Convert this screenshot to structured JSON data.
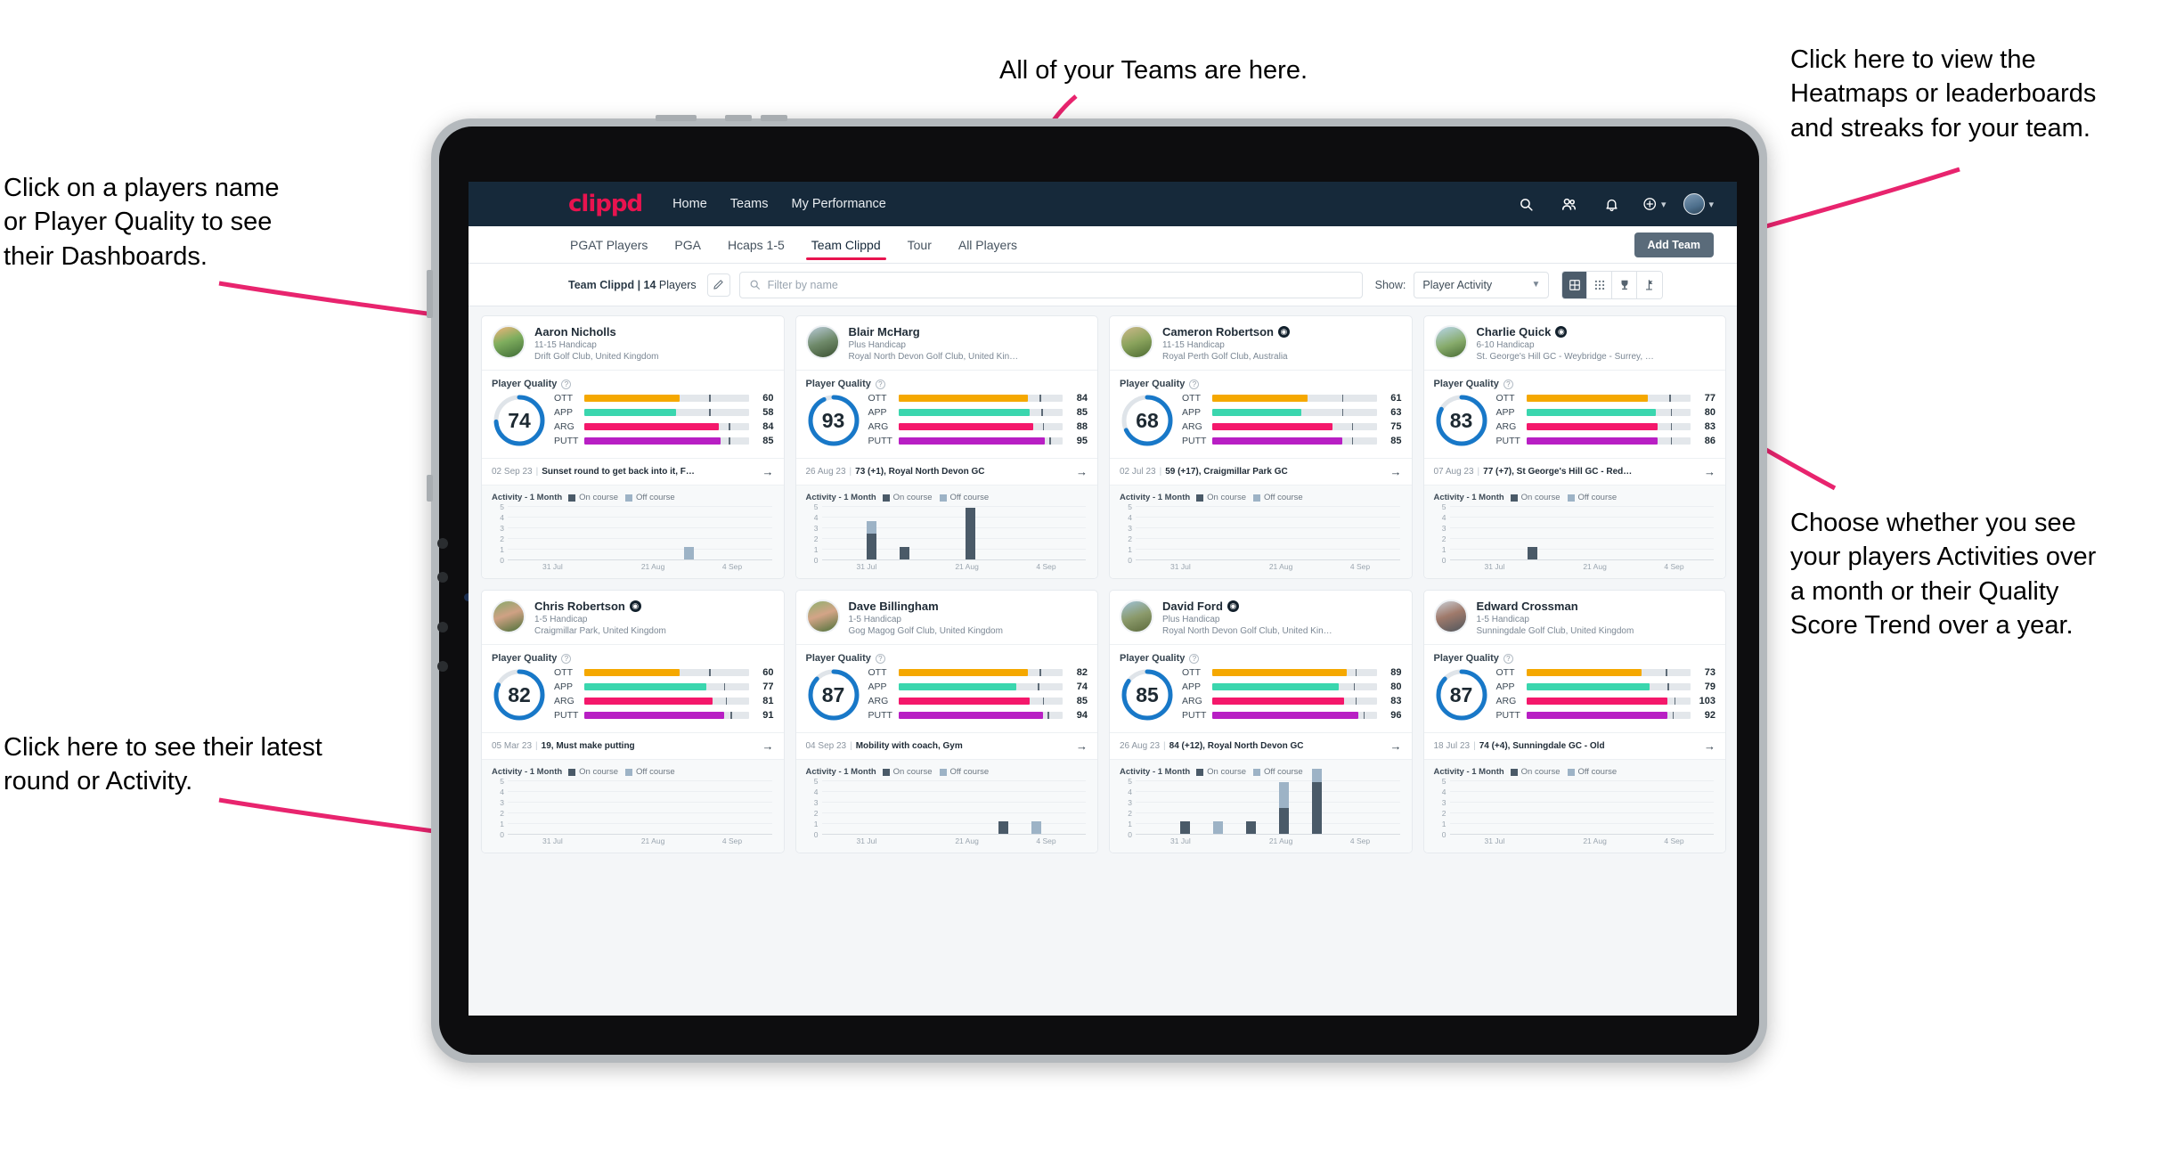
{
  "annotations": {
    "teams": "All of your Teams are here.",
    "heatmaps": "Click here to view the\nHeatmaps or leaderboards\nand streaks for your team.",
    "players": "Click on a players name\nor Player Quality to see\ntheir Dashboards.",
    "choose": "Choose whether you see\nyour players Activities over\na month or their Quality\nScore Trend over a year.",
    "latest": "Click here to see their latest\nround or Activity."
  },
  "colors": {
    "brand": "#e8134f",
    "navbar": "#16293a",
    "accent_blue": "#1878c8",
    "ott": "#f5a800",
    "app": "#3ad6ae",
    "arg": "#f4186b",
    "putt": "#b81fc4",
    "on_course": "#4a5a68",
    "off_course": "#9db3c6",
    "annotation_arrow": "#e8246e"
  },
  "topnav": {
    "brand": "clippd",
    "links": [
      "Home",
      "Teams",
      "My Performance"
    ],
    "icons": [
      "search-icon",
      "people-icon",
      "bell-icon",
      "plus-circle-icon",
      "avatar"
    ]
  },
  "subnav": {
    "tabs": [
      "PGAT Players",
      "PGA",
      "Hcaps 1-5",
      "Team Clippd",
      "Tour",
      "All Players"
    ],
    "active": "Team Clippd",
    "add_team_label": "Add Team"
  },
  "toolbar": {
    "team_name": "Team Clippd",
    "team_separator": " | ",
    "player_count": "14",
    "players_word": " Players",
    "edit_icon": "pencil-icon",
    "search_placeholder": "Filter by name",
    "search_value": "",
    "show_label": "Show:",
    "show_value": "Player Activity",
    "view_buttons": [
      {
        "name": "grid-view-icon",
        "active": true
      },
      {
        "name": "dots-grid-view-icon",
        "active": false
      },
      {
        "name": "trophy-view-icon",
        "active": false
      },
      {
        "name": "flag-view-icon",
        "active": false
      }
    ]
  },
  "card_labels": {
    "player_quality": "Player Quality",
    "activity_title": "Activity - 1 Month",
    "legend_on": "On course",
    "legend_off": "Off course",
    "arrow": "→",
    "help_icon": "help-circle-icon"
  },
  "chart_data": {
    "type": "bar",
    "title": "Activity - 1 Month",
    "xlabel": "",
    "ylabel": "",
    "ylim": [
      0,
      5
    ],
    "yticks": [
      0,
      1,
      2,
      3,
      4,
      5
    ],
    "grid": true,
    "legend": [
      "On course",
      "Off course"
    ],
    "legend_position": "top",
    "x_tick_labels": [
      "31 Jul",
      "21 Aug",
      "4 Sep"
    ],
    "x_tick_positions": [
      0.17,
      0.55,
      0.85
    ],
    "bins": 8,
    "charts": [
      {
        "player": "Aaron Nicholls",
        "on_course": [
          0,
          0,
          0,
          0,
          0,
          0,
          0,
          0
        ],
        "off_course": [
          0,
          0,
          0,
          0,
          0,
          1,
          0,
          0
        ]
      },
      {
        "player": "Blair McHarg",
        "on_course": [
          0,
          2,
          1,
          0,
          4,
          0,
          0,
          0
        ],
        "off_course": [
          0,
          1,
          0,
          0,
          0,
          0,
          0,
          0
        ]
      },
      {
        "player": "Cameron Robertson",
        "on_course": [
          0,
          0,
          0,
          0,
          0,
          0,
          0,
          0
        ],
        "off_course": [
          0,
          0,
          0,
          0,
          0,
          0,
          0,
          0
        ]
      },
      {
        "player": "Charlie Quick",
        "on_course": [
          0,
          0,
          1,
          0,
          0,
          0,
          0,
          0
        ],
        "off_course": [
          0,
          0,
          0,
          0,
          0,
          0,
          0,
          0
        ]
      },
      {
        "player": "Chris Robertson",
        "on_course": [
          0,
          0,
          0,
          0,
          0,
          0,
          0,
          0
        ],
        "off_course": [
          0,
          0,
          0,
          0,
          0,
          0,
          0,
          0
        ]
      },
      {
        "player": "Dave Billingham",
        "on_course": [
          0,
          0,
          0,
          0,
          0,
          1,
          0,
          0
        ],
        "off_course": [
          0,
          0,
          0,
          0,
          0,
          0,
          1,
          0
        ]
      },
      {
        "player": "David Ford",
        "on_course": [
          0,
          1,
          0,
          1,
          2,
          4,
          0,
          0
        ],
        "off_course": [
          0,
          0,
          1,
          0,
          2,
          1,
          0,
          0
        ]
      },
      {
        "player": "Edward Crossman",
        "on_course": [
          0,
          0,
          0,
          0,
          0,
          0,
          0,
          0
        ],
        "off_course": [
          0,
          0,
          0,
          0,
          0,
          0,
          0,
          0
        ]
      }
    ]
  },
  "players": [
    {
      "name": "Aaron Nicholls",
      "verified": false,
      "handicap": "11-15 Handicap",
      "club": "Drift Golf Club, United Kingdom",
      "avatar_grad": "linear-gradient(160deg,#f2b47c 0%, #7fae5e 45%, #3f6b36 100%)",
      "quality": 74,
      "metrics": [
        {
          "label": "OTT",
          "value": 60,
          "fill": 58,
          "tick": 76,
          "color": "#f5a800"
        },
        {
          "label": "APP",
          "value": 58,
          "fill": 56,
          "tick": 76,
          "color": "#3ad6ae"
        },
        {
          "label": "ARG",
          "value": 84,
          "fill": 82,
          "tick": 88,
          "color": "#f4186b"
        },
        {
          "label": "PUTT",
          "value": 85,
          "fill": 83,
          "tick": 88,
          "color": "#b81fc4"
        }
      ],
      "round_date": "02 Sep 23",
      "round_text": "Sunset round to get back into it, F…"
    },
    {
      "name": "Blair McHarg",
      "verified": false,
      "handicap": "Plus Handicap",
      "club": "Royal North Devon Golf Club, United Kin…",
      "avatar_grad": "linear-gradient(160deg,#b9cbd8 0%, #6f8a6a 50%, #3b5132 100%)",
      "quality": 93,
      "metrics": [
        {
          "label": "OTT",
          "value": 84,
          "fill": 79,
          "tick": 86,
          "color": "#f5a800"
        },
        {
          "label": "APP",
          "value": 85,
          "fill": 80,
          "tick": 87,
          "color": "#3ad6ae"
        },
        {
          "label": "ARG",
          "value": 88,
          "fill": 82,
          "tick": 88,
          "color": "#f4186b"
        },
        {
          "label": "PUTT",
          "value": 95,
          "fill": 89,
          "tick": 92,
          "color": "#b81fc4"
        }
      ],
      "round_date": "26 Aug 23",
      "round_text": "73 (+1), Royal North Devon GC"
    },
    {
      "name": "Cameron Robertson",
      "verified": true,
      "handicap": "11-15 Handicap",
      "club": "Royal Perth Golf Club, Australia",
      "avatar_grad": "linear-gradient(160deg,#cdb98a 0%, #8aa35c 50%, #4d6b33 100%)",
      "quality": 68,
      "metrics": [
        {
          "label": "OTT",
          "value": 61,
          "fill": 58,
          "tick": 79,
          "color": "#f5a800"
        },
        {
          "label": "APP",
          "value": 63,
          "fill": 54,
          "tick": 79,
          "color": "#3ad6ae"
        },
        {
          "label": "ARG",
          "value": 75,
          "fill": 73,
          "tick": 85,
          "color": "#f4186b"
        },
        {
          "label": "PUTT",
          "value": 85,
          "fill": 79,
          "tick": 85,
          "color": "#b81fc4"
        }
      ],
      "round_date": "02 Jul 23",
      "round_text": "59 (+17), Craigmillar Park GC"
    },
    {
      "name": "Charlie Quick",
      "verified": true,
      "handicap": "6-10 Handicap",
      "club": "St. George's Hill GC - Weybridge - Surrey, …",
      "avatar_grad": "linear-gradient(160deg,#b8d6ea 0%, #87ab6b 55%, #486b34 100%)",
      "quality": 83,
      "metrics": [
        {
          "label": "OTT",
          "value": 77,
          "fill": 74,
          "tick": 87,
          "color": "#f5a800"
        },
        {
          "label": "APP",
          "value": 80,
          "fill": 79,
          "tick": 88,
          "color": "#3ad6ae"
        },
        {
          "label": "ARG",
          "value": 83,
          "fill": 80,
          "tick": 88,
          "color": "#f4186b"
        },
        {
          "label": "PUTT",
          "value": 86,
          "fill": 80,
          "tick": 88,
          "color": "#b81fc4"
        }
      ],
      "round_date": "07 Aug 23",
      "round_text": "77 (+7), St George's Hill GC - Red…"
    },
    {
      "name": "Chris Robertson",
      "verified": true,
      "handicap": "1-5 Handicap",
      "club": "Craigmillar Park, United Kingdom",
      "avatar_grad": "linear-gradient(160deg,#86a86a 0%, #cfa184 45%, #4a7038 100%)",
      "quality": 82,
      "metrics": [
        {
          "label": "OTT",
          "value": 60,
          "fill": 58,
          "tick": 76,
          "color": "#f5a800"
        },
        {
          "label": "APP",
          "value": 77,
          "fill": 74,
          "tick": 85,
          "color": "#3ad6ae"
        },
        {
          "label": "ARG",
          "value": 81,
          "fill": 78,
          "tick": 86,
          "color": "#f4186b"
        },
        {
          "label": "PUTT",
          "value": 91,
          "fill": 85,
          "tick": 89,
          "color": "#b81fc4"
        }
      ],
      "round_date": "05 Mar 23",
      "round_text": "19, Must make putting"
    },
    {
      "name": "Dave Billingham",
      "verified": false,
      "handicap": "1-5 Handicap",
      "club": "Gog Magog Golf Club, United Kingdom",
      "avatar_grad": "linear-gradient(160deg,#8fb06e 0%, #d3a487 45%, #4c7139 100%)",
      "quality": 87,
      "metrics": [
        {
          "label": "OTT",
          "value": 82,
          "fill": 79,
          "tick": 86,
          "color": "#f5a800"
        },
        {
          "label": "APP",
          "value": 74,
          "fill": 72,
          "tick": 85,
          "color": "#3ad6ae"
        },
        {
          "label": "ARG",
          "value": 85,
          "fill": 80,
          "tick": 88,
          "color": "#f4186b"
        },
        {
          "label": "PUTT",
          "value": 94,
          "fill": 88,
          "tick": 91,
          "color": "#b81fc4"
        }
      ],
      "round_date": "04 Sep 23",
      "round_text": "Mobility with coach, Gym"
    },
    {
      "name": "David Ford",
      "verified": true,
      "handicap": "Plus Handicap",
      "club": "Royal North Devon Golf Club, United Kin…",
      "avatar_grad": "linear-gradient(160deg,#9fc2d8 0%, #8b9a6b 50%, #5c6a3c 100%)",
      "quality": 85,
      "metrics": [
        {
          "label": "OTT",
          "value": 89,
          "fill": 82,
          "tick": 87,
          "color": "#f5a800"
        },
        {
          "label": "APP",
          "value": 80,
          "fill": 77,
          "tick": 86,
          "color": "#3ad6ae"
        },
        {
          "label": "ARG",
          "value": 83,
          "fill": 80,
          "tick": 87,
          "color": "#f4186b"
        },
        {
          "label": "PUTT",
          "value": 96,
          "fill": 89,
          "tick": 92,
          "color": "#b81fc4"
        }
      ],
      "round_date": "26 Aug 23",
      "round_text": "84 (+12), Royal North Devon GC"
    },
    {
      "name": "Edward Crossman",
      "verified": false,
      "handicap": "1-5 Handicap",
      "club": "Sunningdale Golf Club, United Kingdom",
      "avatar_grad": "linear-gradient(160deg,#c9cfd6 0%, #a07a6b 45%, #4f565d 100%)",
      "quality": 87,
      "metrics": [
        {
          "label": "OTT",
          "value": 73,
          "fill": 70,
          "tick": 85,
          "color": "#f5a800"
        },
        {
          "label": "APP",
          "value": 79,
          "fill": 75,
          "tick": 86,
          "color": "#3ad6ae"
        },
        {
          "label": "ARG",
          "value": 103,
          "fill": 86,
          "tick": 90,
          "color": "#f4186b"
        },
        {
          "label": "PUTT",
          "value": 92,
          "fill": 86,
          "tick": 89,
          "color": "#b81fc4"
        }
      ],
      "round_date": "18 Jul 23",
      "round_text": "74 (+4), Sunningdale GC - Old"
    }
  ]
}
